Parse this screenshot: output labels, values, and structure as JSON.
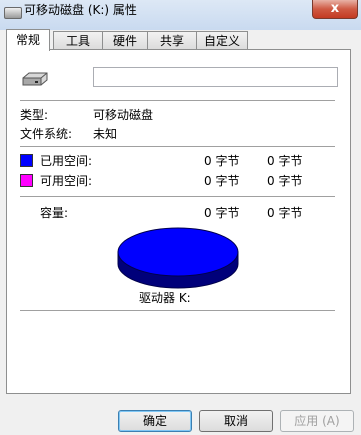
{
  "window": {
    "title": "可移动磁盘 (K:) 属性",
    "close_label": "x"
  },
  "tabs": [
    {
      "label": "常规",
      "active": true
    },
    {
      "label": "工具",
      "active": false
    },
    {
      "label": "硬件",
      "active": false
    },
    {
      "label": "共享",
      "active": false
    },
    {
      "label": "自定义",
      "active": false
    }
  ],
  "general": {
    "drive_name_value": "",
    "type_label": "类型:",
    "type_value": "可移动磁盘",
    "fs_label": "文件系统:",
    "fs_value": "未知",
    "used_label": "已用空间:",
    "used_bytes": "0 字节",
    "used_size": "0 字节",
    "free_label": "可用空间:",
    "free_bytes": "0 字节",
    "free_size": "0 字节",
    "capacity_label": "容量:",
    "capacity_bytes": "0 字节",
    "capacity_size": "0 字节",
    "drive_label": "驱动器 K:",
    "used_color": "#0000ff",
    "free_color": "#ff00ff"
  },
  "buttons": {
    "ok": "确定",
    "cancel": "取消",
    "apply": "应用 (A)"
  }
}
